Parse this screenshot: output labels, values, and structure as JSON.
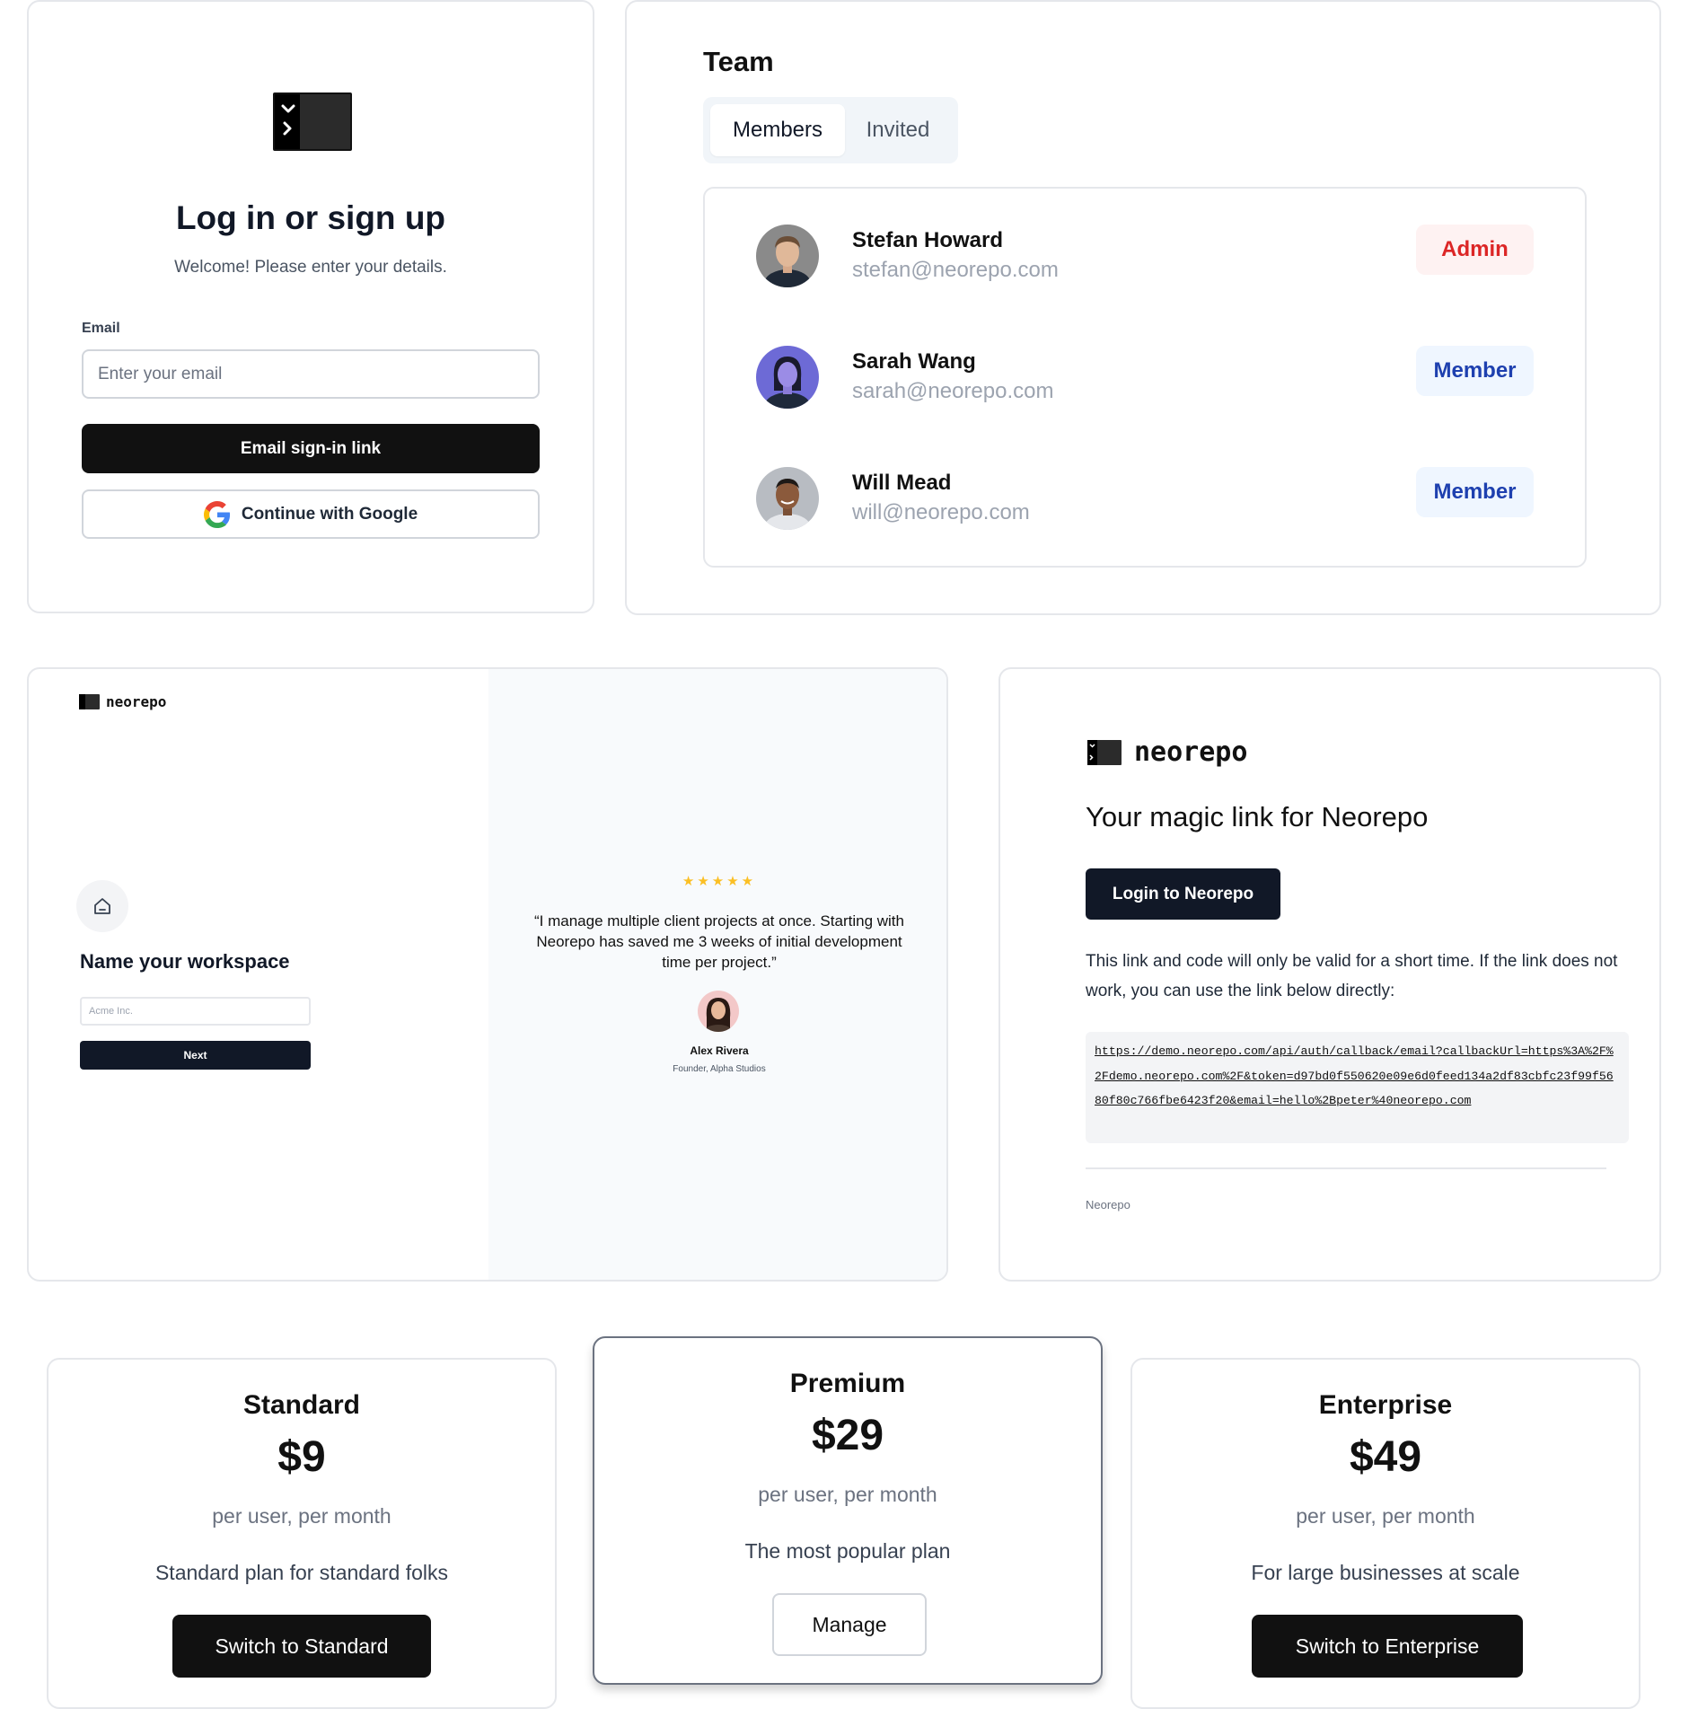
{
  "login": {
    "title": "Log in or sign up",
    "subtitle": "Welcome! Please enter your details.",
    "email_label": "Email",
    "email_placeholder": "Enter your email",
    "email_value": "",
    "signin_button": "Email sign-in link",
    "google_button": "Continue with Google"
  },
  "team": {
    "title": "Team",
    "tabs": [
      {
        "label": "Members",
        "active": true
      },
      {
        "label": "Invited",
        "active": false
      }
    ],
    "members": [
      {
        "name": "Stefan Howard",
        "email": "stefan@neorepo.com",
        "role": "Admin",
        "role_color": "#dc2626"
      },
      {
        "name": "Sarah Wang",
        "email": "sarah@neorepo.com",
        "role": "Member",
        "role_color": "#1e40af"
      },
      {
        "name": "Will Mead",
        "email": "will@neorepo.com",
        "role": "Member",
        "role_color": "#1e40af"
      }
    ]
  },
  "workspace": {
    "brand": "neorepo",
    "title": "Name your workspace",
    "input_placeholder": "Acme Inc.",
    "input_value": "",
    "next_button": "Next",
    "rating": 5,
    "stars": "★★★★★",
    "quote": "“I manage multiple client projects at once. Starting with Neorepo has saved me 3 weeks of initial development time per project.”",
    "author_name": "Alex Rivera",
    "author_role": "Founder, Alpha Studios"
  },
  "magic_email": {
    "brand": "neorepo",
    "heading": "Your magic link for Neorepo",
    "button": "Login to Neorepo",
    "body": "This link and code will only be valid for a short time. If the link does not work, you can use the link below directly:",
    "link": "https://demo.neorepo.com/api/auth/callback/email?callbackUrl=https%3A%2F%2Fdemo.neorepo.com%2F&token=d97bd0f550620e09e6d0feed134a2df83cbfc23f99f5680f80c766fbe6423f20&email=hello%2Bpeter%40neorepo.com",
    "footer": "Neorepo"
  },
  "pricing": {
    "plans": [
      {
        "name": "Standard",
        "price": "$9",
        "per": "per user, per month",
        "description": "Standard plan for standard folks",
        "button": "Switch to Standard",
        "current": false
      },
      {
        "name": "Premium",
        "price": "$29",
        "per": "per user, per month",
        "description": "The most popular plan",
        "button": "Manage",
        "current": true
      },
      {
        "name": "Enterprise",
        "price": "$49",
        "per": "per user, per month",
        "description": "For large businesses at scale",
        "button": "Switch to Enterprise",
        "current": false
      }
    ]
  },
  "colors": {
    "primary_dark": "#111111",
    "navy": "#111827",
    "admin_red": "#dc2626",
    "member_blue": "#1e40af",
    "star_gold": "#fbbf24",
    "border": "#e5e7eb"
  }
}
